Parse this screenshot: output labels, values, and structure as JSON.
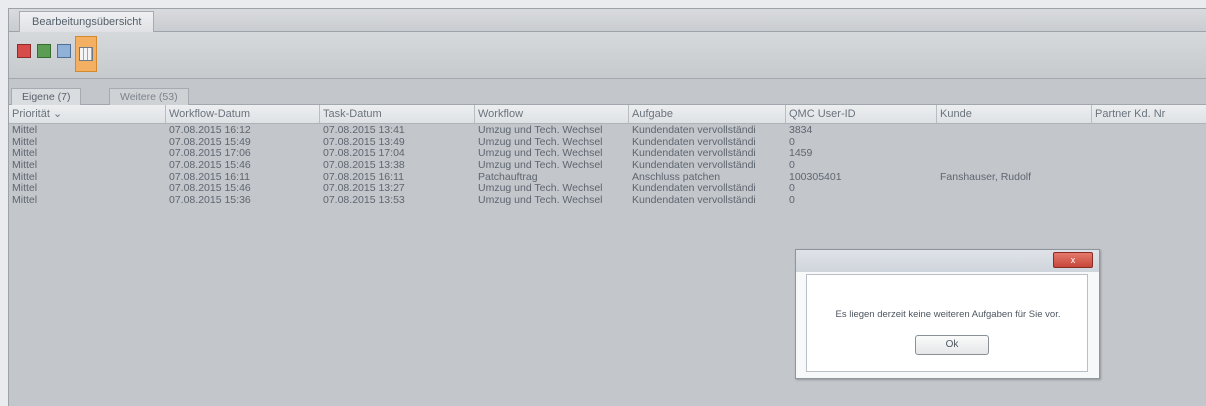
{
  "top_tab": {
    "label": "Bearbeitungsübersicht"
  },
  "toolbar": {
    "buttons": [
      {
        "icon": "pdf-export-icon"
      },
      {
        "icon": "excel-export-icon"
      },
      {
        "icon": "document-icon"
      },
      {
        "icon": "table-view-icon"
      }
    ]
  },
  "subtabs": {
    "own": "Eigene (7)",
    "other": "Weitere (53)"
  },
  "table": {
    "columns": [
      "Priorität",
      "Workflow-Datum",
      "Task-Datum",
      "Workflow",
      "Aufgabe",
      "QMC User-ID",
      "Kunde",
      "Partner Kd. Nr"
    ],
    "sort_indicator": "⌄",
    "rows": [
      [
        "Mittel",
        "07.08.2015 16:12",
        "07.08.2015 13:41",
        "Umzug und Tech. Wechsel",
        "Kundendaten vervollständi",
        "3834",
        "",
        ""
      ],
      [
        "Mittel",
        "07.08.2015 15:49",
        "07.08.2015 13:49",
        "Umzug und Tech. Wechsel",
        "Kundendaten vervollständi",
        "0",
        "",
        ""
      ],
      [
        "Mittel",
        "07.08.2015 17:06",
        "07.08.2015 17:04",
        "Umzug und Tech. Wechsel",
        "Kundendaten vervollständi",
        "1459",
        "",
        ""
      ],
      [
        "Mittel",
        "07.08.2015 15:46",
        "07.08.2015 13:38",
        "Umzug und Tech. Wechsel",
        "Kundendaten vervollständi",
        "0",
        "",
        ""
      ],
      [
        "Mittel",
        "07.08.2015 16:11",
        "07.08.2015 16:11",
        "Patchauftrag",
        "Anschluss patchen",
        "100305401",
        "Fanshauser, Rudolf",
        ""
      ],
      [
        "Mittel",
        "07.08.2015 15:46",
        "07.08.2015 13:27",
        "Umzug und Tech. Wechsel",
        "Kundendaten vervollständi",
        "0",
        "",
        ""
      ],
      [
        "Mittel",
        "07.08.2015 15:36",
        "07.08.2015 13:53",
        "Umzug und Tech. Wechsel",
        "Kundendaten vervollständi",
        "0",
        "",
        ""
      ]
    ]
  },
  "dialog": {
    "close_label": "x",
    "message": "Es liegen derzeit keine weiteren Aufgaben für Sie vor.",
    "ok_label": "Ok"
  }
}
